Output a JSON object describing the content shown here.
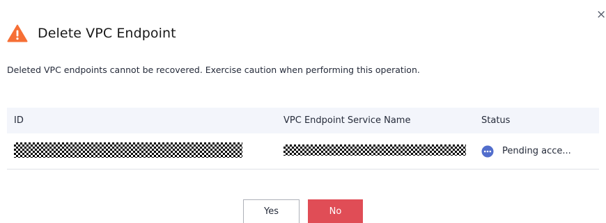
{
  "dialog": {
    "title": "Delete VPC Endpoint",
    "close_glyph": "×",
    "warning_icon": "warning-triangle-icon",
    "description": "Deleted VPC endpoints cannot be recovered. Exercise caution when performing this operation."
  },
  "table": {
    "headers": {
      "id": "ID",
      "service_name": "VPC Endpoint Service Name",
      "status": "Status"
    },
    "rows": [
      {
        "status": "Pending acce..."
      }
    ]
  },
  "buttons": {
    "yes": "Yes",
    "no": "No"
  },
  "colors": {
    "warning": "#f66f35",
    "status_dot": "#526ecc",
    "danger_button": "#e04d56",
    "header_bg": "#f3f5fb"
  }
}
